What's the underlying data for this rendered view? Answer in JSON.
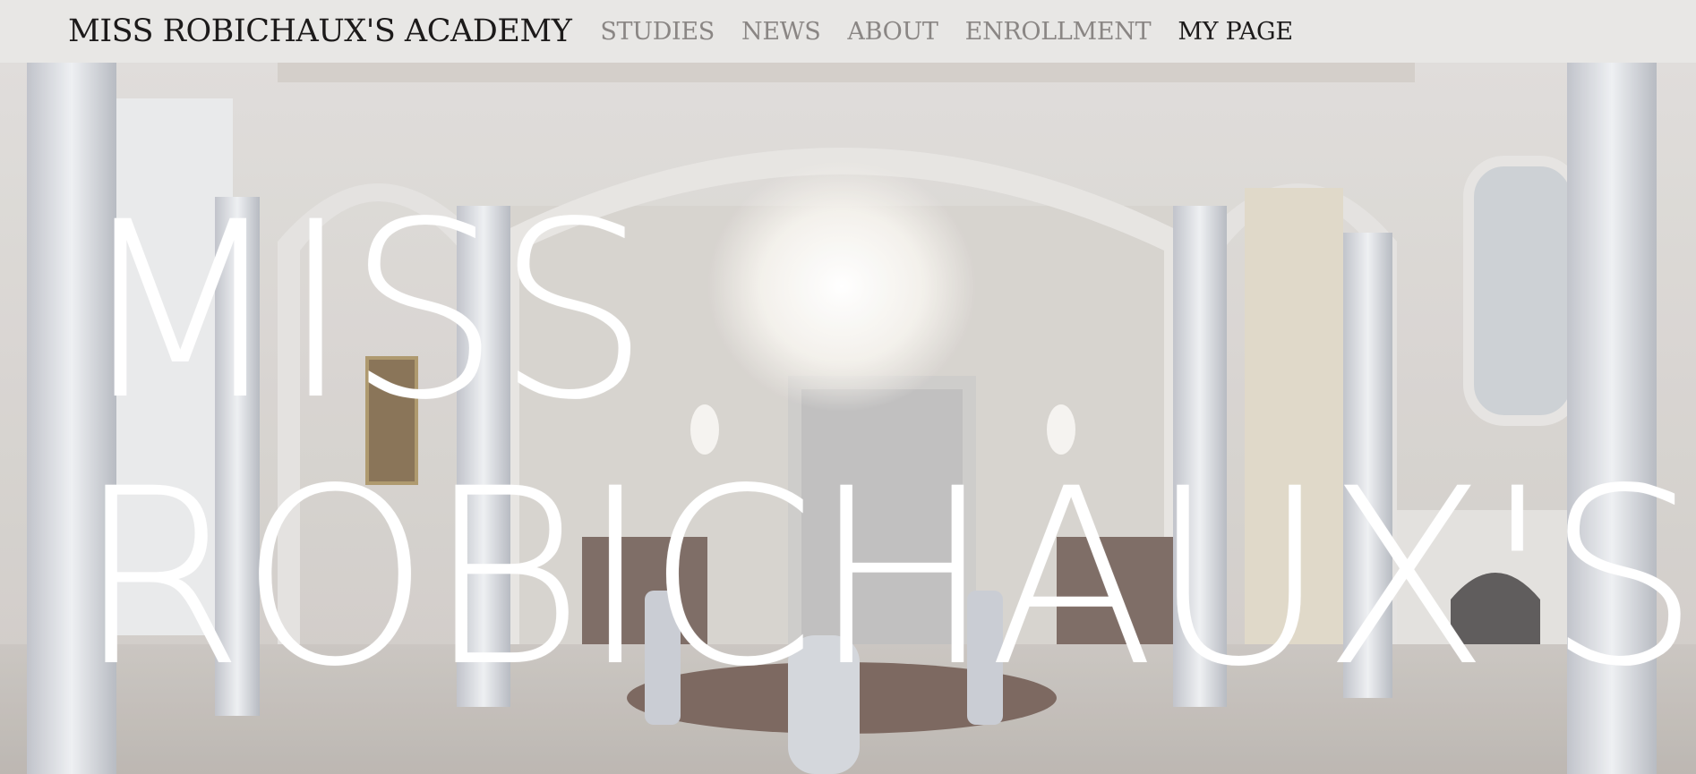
{
  "navbar": {
    "brand": "MISS ROBICHAUX'S ACADEMY",
    "links": [
      {
        "label": "STUDIES",
        "active": false
      },
      {
        "label": "NEWS",
        "active": false
      },
      {
        "label": "ABOUT",
        "active": false
      },
      {
        "label": "ENROLLMENT",
        "active": false
      },
      {
        "label": "MY PAGE",
        "active": true
      }
    ]
  },
  "hero": {
    "title_line1": "MISS",
    "title_line2": "ROBICHAUX'S",
    "image_subject": "grand white dining hall with arches, columns and crystal chandelier"
  },
  "colors": {
    "navbar_bg": "#e8e7e5",
    "nav_text_inactive": "#8a8684",
    "nav_text_active": "#1c1a1a",
    "hero_title": "#ffffff"
  }
}
